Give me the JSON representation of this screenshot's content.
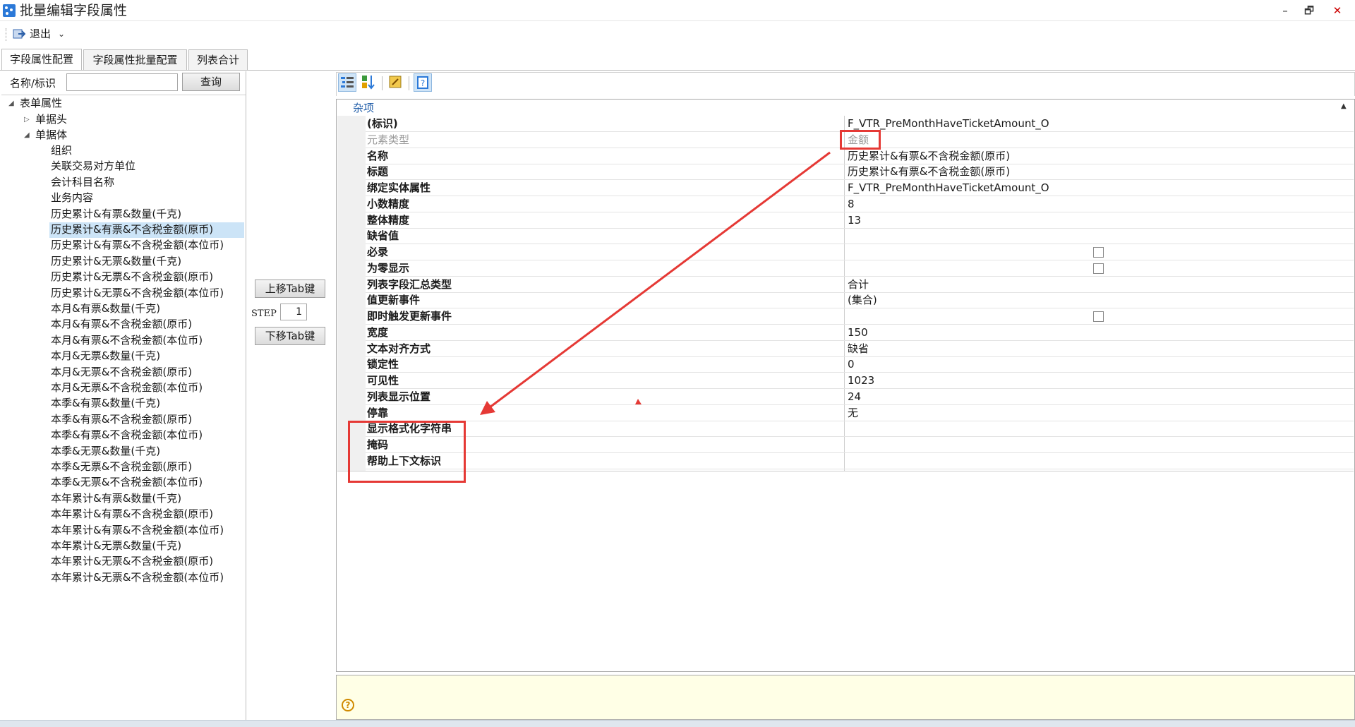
{
  "window": {
    "title": "批量编辑字段属性",
    "minimize": "–",
    "restore": "🗗",
    "close": "✕"
  },
  "toolbar": {
    "exit_label": "退出",
    "exit_caret": "⌄"
  },
  "tabs": [
    {
      "label": "字段属性配置",
      "active": true
    },
    {
      "label": "字段属性批量配置",
      "active": false
    },
    {
      "label": "列表合计",
      "active": false
    }
  ],
  "search": {
    "label": "名称/标识",
    "value": "",
    "button": "查询"
  },
  "tree": {
    "root": {
      "label": "表单属性",
      "expander": "◢"
    },
    "header_node": {
      "label": "单据头",
      "expander": "▷"
    },
    "body_node": {
      "label": "单据体",
      "expander": "◢"
    },
    "items": [
      "组织",
      "关联交易对方单位",
      "会计科目名称",
      "业务内容",
      "历史累计&有票&数量(千克)",
      "历史累计&有票&不含税金额(原币)",
      "历史累计&有票&不含税金额(本位币)",
      "历史累计&无票&数量(千克)",
      "历史累计&无票&不含税金额(原币)",
      "历史累计&无票&不含税金额(本位币)",
      "本月&有票&数量(千克)",
      "本月&有票&不含税金额(原币)",
      "本月&有票&不含税金额(本位币)",
      "本月&无票&数量(千克)",
      "本月&无票&不含税金额(原币)",
      "本月&无票&不含税金额(本位币)",
      "本季&有票&数量(千克)",
      "本季&有票&不含税金额(原币)",
      "本季&有票&不含税金额(本位币)",
      "本季&无票&数量(千克)",
      "本季&无票&不含税金额(原币)",
      "本季&无票&不含税金额(本位币)",
      "本年累计&有票&数量(千克)",
      "本年累计&有票&不含税金额(原币)",
      "本年累计&有票&不含税金额(本位币)",
      "本年累计&无票&数量(千克)",
      "本年累计&无票&不含税金额(原币)",
      "本年累计&无票&不含税金额(本位币)"
    ],
    "selected_index": 5
  },
  "middle": {
    "tab_up_button": "上移Tab键",
    "step_label": "STEP",
    "step_value": "1",
    "tab_down_button": "下移Tab键"
  },
  "prop_toolbar": {
    "icons": [
      "categorized-icon",
      "sort-alphabetical-icon",
      "property-pages-icon",
      "help-toggle-icon"
    ]
  },
  "property_grid": {
    "category": "杂项",
    "collapse_glyph": "▲",
    "rows": [
      {
        "name": "(标识)",
        "value": "F_VTR_PreMonthHaveTicketAmount_O",
        "gray": false,
        "checkbox": false
      },
      {
        "name": "元素类型",
        "value": "金额",
        "gray": true,
        "checkbox": false
      },
      {
        "name": "名称",
        "value": "历史累计&有票&不含税金额(原币)",
        "gray": false,
        "checkbox": false
      },
      {
        "name": "标题",
        "value": "历史累计&有票&不含税金额(原币)",
        "gray": false,
        "checkbox": false
      },
      {
        "name": "绑定实体属性",
        "value": "F_VTR_PreMonthHaveTicketAmount_O",
        "gray": false,
        "checkbox": false
      },
      {
        "name": "小数精度",
        "value": "8",
        "gray": false,
        "checkbox": false
      },
      {
        "name": "整体精度",
        "value": "13",
        "gray": false,
        "checkbox": false
      },
      {
        "name": "缺省值",
        "value": "",
        "gray": false,
        "checkbox": false
      },
      {
        "name": "必录",
        "value": "",
        "gray": false,
        "checkbox": true
      },
      {
        "name": "为零显示",
        "value": "",
        "gray": false,
        "checkbox": true
      },
      {
        "name": "列表字段汇总类型",
        "value": "合计",
        "gray": false,
        "checkbox": false
      },
      {
        "name": "值更新事件",
        "value": "(集合)",
        "gray": false,
        "checkbox": false
      },
      {
        "name": "即时触发更新事件",
        "value": "",
        "gray": false,
        "checkbox": true
      },
      {
        "name": "宽度",
        "value": "150",
        "gray": false,
        "checkbox": false
      },
      {
        "name": "文本对齐方式",
        "value": "缺省",
        "gray": false,
        "checkbox": false
      },
      {
        "name": "锁定性",
        "value": "0",
        "gray": false,
        "checkbox": false
      },
      {
        "name": "可见性",
        "value": "1023",
        "gray": false,
        "checkbox": false
      },
      {
        "name": "列表显示位置",
        "value": "24",
        "gray": false,
        "checkbox": false
      },
      {
        "name": "停靠",
        "value": "无",
        "gray": false,
        "checkbox": false
      },
      {
        "name": "显示格式化字符串",
        "value": "",
        "gray": false,
        "checkbox": false
      },
      {
        "name": "掩码",
        "value": "",
        "gray": false,
        "checkbox": false
      },
      {
        "name": "帮助上下文标识",
        "value": "",
        "gray": false,
        "checkbox": false
      }
    ]
  },
  "help": {
    "icon_glyph": "?"
  },
  "annotation_color": "#e53935",
  "selection_color": "#cce4f7",
  "accent_color": "#2b79d8"
}
